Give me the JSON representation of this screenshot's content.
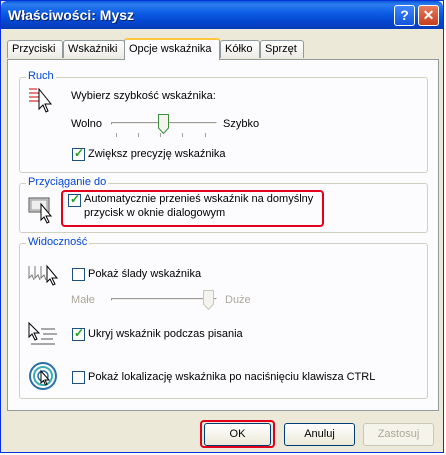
{
  "window": {
    "title": "Właściwości: Mysz",
    "help_glyph": "?",
    "close_glyph": "✕"
  },
  "tabs": [
    {
      "label": "Przyciski"
    },
    {
      "label": "Wskaźniki"
    },
    {
      "label": "Opcje wskaźnika",
      "active": true
    },
    {
      "label": "Kółko"
    },
    {
      "label": "Sprzęt"
    }
  ],
  "motion": {
    "group_label": "Ruch",
    "speed_label": "Wybierz szybkość wskaźnika:",
    "slow_label": "Wolno",
    "fast_label": "Szybko",
    "speed_value": 0.5,
    "precision_label": "Zwiększ precyzję wskaźnika",
    "precision_checked": true
  },
  "snap": {
    "group_label": "Przyciąganie do",
    "snap_label_line1": "Automatycznie przenieś wskaźnik na domyślny",
    "snap_label_line2": "przycisk w oknie dialogowym",
    "snap_checked": true
  },
  "visibility": {
    "group_label": "Widoczność",
    "trails_label": "Pokaż ślady wskaźnika",
    "trails_checked": false,
    "short_label": "Małe",
    "long_label": "Duże",
    "trails_value": 1.0,
    "hide_label": "Ukryj wskaźnik podczas pisania",
    "hide_checked": true,
    "ctrl_label": "Pokaż lokalizację wskaźnika po naciśnięciu klawisza CTRL",
    "ctrl_checked": false
  },
  "buttons": {
    "ok": "OK",
    "cancel": "Anuluj",
    "apply": "Zastosuj"
  },
  "colors": {
    "group_label": "#0046d5",
    "highlight_box": "#e2001a",
    "checkmark": "#21a121"
  },
  "icons": [
    "help-icon",
    "close-icon",
    "pointer-speed-icon",
    "snap-to-icon",
    "pointer-trails-icon",
    "hide-pointer-icon",
    "locate-pointer-icon",
    "checkmark-icon"
  ]
}
